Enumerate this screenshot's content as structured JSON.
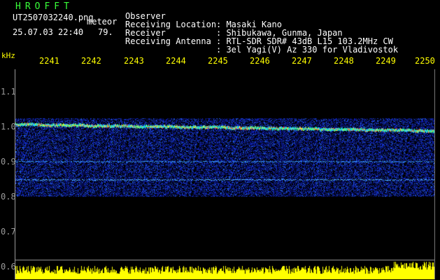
{
  "header": {
    "app_title": "HROFFT",
    "filename": "UT2507032240.png",
    "type_label": "meteor",
    "datetime": "25.07.03 22:40",
    "count": "79."
  },
  "info": [
    {
      "label": "Observer",
      "value": ": Masaki Kano"
    },
    {
      "label": "Receiving Location",
      "value": ": Shibukawa, Gunma, Japan"
    },
    {
      "label": "Receiver",
      "value": ": RTL-SDR SDR# 43dB L15 103.2MHz CW"
    },
    {
      "label": "Receiving Antenna",
      "value": ": 3el Yagi(V) Az 330 for Vladivostok"
    }
  ],
  "axis": {
    "unit": "kHz",
    "x_ticks": [
      "2241",
      "2242",
      "2243",
      "2244",
      "2245",
      "2246",
      "2247",
      "2248",
      "2249",
      "2250"
    ],
    "y_ticks": [
      "1.1",
      "1.0",
      "0.9",
      "0.8",
      "0.7",
      "0.6"
    ]
  },
  "colors": {
    "title": "#39ff39",
    "tick_x": "#ffff00",
    "tick_y": "#9a9a9a",
    "signal_low": "#0a1aa0",
    "signal_high": "#ff3030",
    "bottom_band": "#ffff00"
  }
}
